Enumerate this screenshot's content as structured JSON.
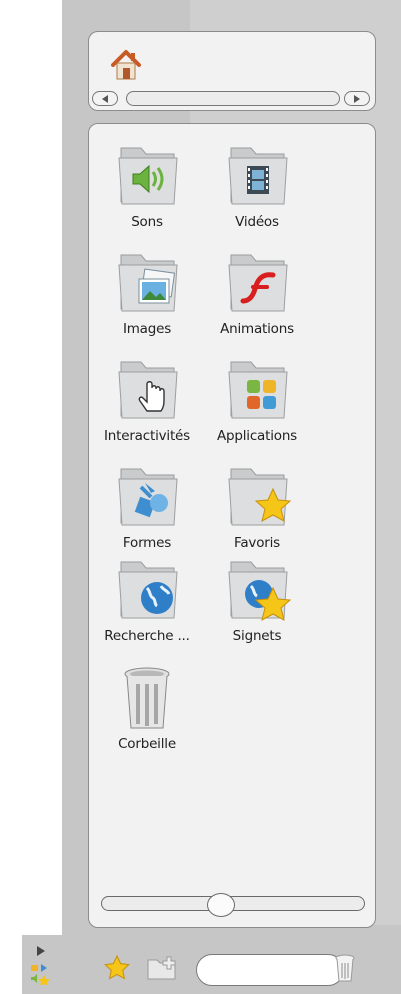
{
  "navigation": {
    "home_icon": "home-icon",
    "scroll_left_icon": "triangle-left-icon",
    "scroll_right_icon": "triangle-right-icon"
  },
  "folders": [
    {
      "label": "Sons",
      "icon": "sound-folder-icon"
    },
    {
      "label": "Vidéos",
      "icon": "film-folder-icon"
    },
    {
      "label": "Images",
      "icon": "image-folder-icon"
    },
    {
      "label": "Animations",
      "icon": "flash-folder-icon"
    },
    {
      "label": "Interactivités",
      "icon": "pointer-hand-folder-icon"
    },
    {
      "label": "Applications",
      "icon": "apps-folder-icon"
    },
    {
      "label": "Formes",
      "icon": "shapes-folder-icon"
    },
    {
      "label": "Favoris",
      "icon": "star-folder-icon"
    },
    {
      "label": "Recherche ...",
      "icon": "globe-folder-icon"
    },
    {
      "label": "Signets",
      "icon": "globe-star-folder-icon"
    },
    {
      "label": "Corbeille",
      "icon": "trash-can-icon"
    }
  ],
  "zoom_slider": {
    "value": 0.45
  },
  "toolbar": {
    "favorite_icon": "star-icon",
    "new_folder_icon": "new-folder-icon",
    "search_value": "",
    "trash_icon": "trash-icon"
  },
  "colors": {
    "panel_bg": "#c6c6c6",
    "content_bg": "#f2f2f2",
    "folder": "#d3d5d6",
    "star": "#f5c518",
    "home_roof": "#d4662a"
  }
}
